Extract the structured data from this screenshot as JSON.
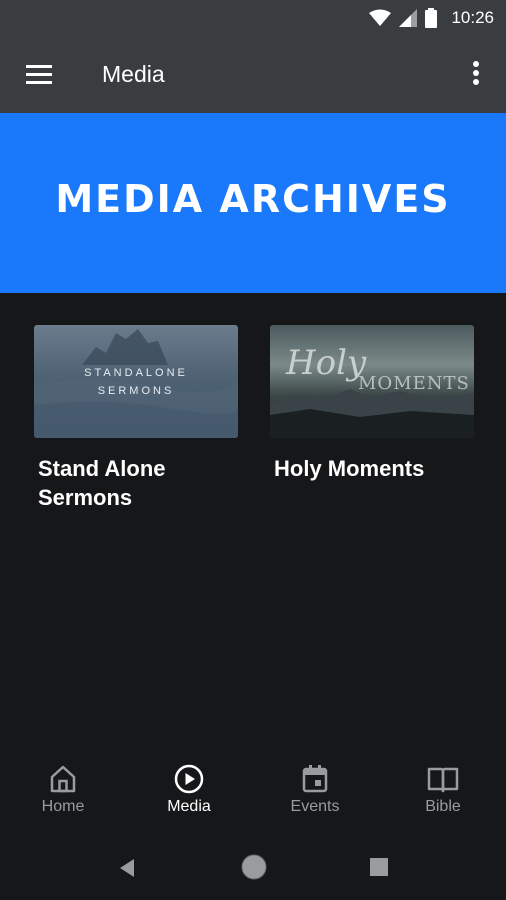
{
  "status_bar": {
    "time": "10:26"
  },
  "app_bar": {
    "title": "Media"
  },
  "banner": {
    "text": "MEDIA ARCHIVES"
  },
  "cards": [
    {
      "title": "Stand Alone Sermons",
      "thumb_line1": "STANDALONE",
      "thumb_line2": "SERMONS"
    },
    {
      "title": "Holy Moments",
      "thumb_line1": "Holy",
      "thumb_line2": "MOMENTS"
    }
  ],
  "bottom_nav": {
    "items": [
      {
        "label": "Home",
        "icon": "home-icon"
      },
      {
        "label": "Media",
        "icon": "play-circle-icon",
        "active": true
      },
      {
        "label": "Events",
        "icon": "calendar-icon"
      },
      {
        "label": "Bible",
        "icon": "book-icon"
      }
    ]
  },
  "colors": {
    "banner": "#1a78fb",
    "app_bar": "#3a3d40",
    "background": "#161719"
  }
}
